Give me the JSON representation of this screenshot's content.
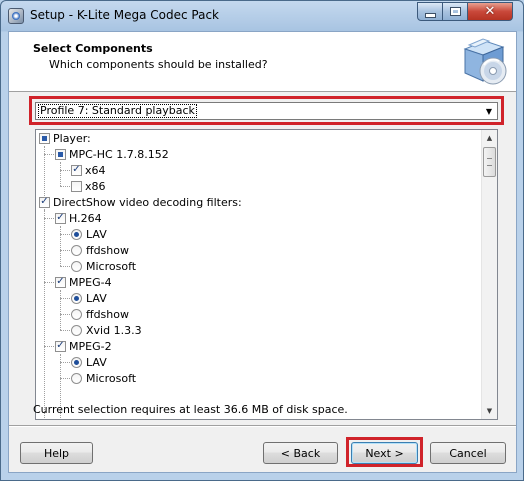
{
  "window": {
    "title": "Setup - K-Lite Mega Codec Pack",
    "close_glyph": "✕"
  },
  "header": {
    "title": "Select Components",
    "subtitle": "Which components should be installed?",
    "icon": "install-box-cd-icon"
  },
  "profile": {
    "selected": "Profile 7: Standard playback",
    "arrow": "▼"
  },
  "tree": {
    "items": [
      {
        "label": "Player:",
        "type": "checkbox",
        "state": "partial"
      },
      {
        "label": "MPC-HC 1.7.8.152",
        "type": "checkbox",
        "state": "partial"
      },
      {
        "label": "x64",
        "type": "checkbox",
        "state": "checked"
      },
      {
        "label": "x86",
        "type": "checkbox",
        "state": "unchecked"
      },
      {
        "label": "DirectShow video decoding filters:",
        "type": "checkbox",
        "state": "checked"
      },
      {
        "label": "H.264",
        "type": "checkbox",
        "state": "checked"
      },
      {
        "label": "LAV",
        "type": "radio",
        "state": "on"
      },
      {
        "label": "ffdshow",
        "type": "radio",
        "state": "off"
      },
      {
        "label": "Microsoft",
        "type": "radio",
        "state": "off"
      },
      {
        "label": "MPEG-4",
        "type": "checkbox",
        "state": "checked"
      },
      {
        "label": "LAV",
        "type": "radio",
        "state": "on"
      },
      {
        "label": "ffdshow",
        "type": "radio",
        "state": "off"
      },
      {
        "label": "Xvid 1.3.3",
        "type": "radio",
        "state": "off"
      },
      {
        "label": "MPEG-2",
        "type": "checkbox",
        "state": "checked"
      },
      {
        "label": "LAV",
        "type": "radio",
        "state": "on"
      },
      {
        "label": "Microsoft",
        "type": "radio",
        "state": "off"
      }
    ],
    "check_glyph": "✓",
    "scroll_up": "▲",
    "scroll_down": "▼"
  },
  "disk_space_text": "Current selection requires at least 36.6 MB of disk space.",
  "buttons": {
    "help": "Help",
    "back": "< Back",
    "next": "Next >",
    "cancel": "Cancel"
  }
}
